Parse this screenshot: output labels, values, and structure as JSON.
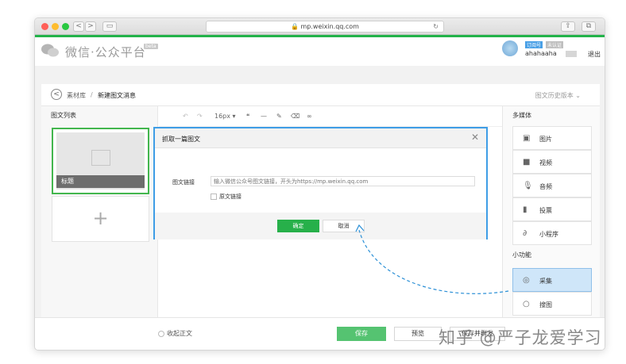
{
  "browser": {
    "url": "mp.weixin.qq.com",
    "nav_back": "<",
    "nav_forward": ">",
    "reload": "↻",
    "traffic_colors": [
      "#ff5f57",
      "#febc2e",
      "#28c840"
    ]
  },
  "header": {
    "logo_text": "微信·公众平台",
    "beta_label": "beta",
    "badge_1": "订阅号",
    "badge_2": "未认证",
    "username": "ahahaaha",
    "logout": "退出"
  },
  "breadcrumb": {
    "parent": "素材库",
    "separator": "/",
    "current": "新建图文消息",
    "history": "图文历史版本"
  },
  "left_column": {
    "title": "图文列表",
    "article_title": "标题",
    "add_symbol": "+"
  },
  "toolbar": {
    "undo": "↶",
    "redo": "↷",
    "font_size": "16px",
    "quote": "❝",
    "hr": "—",
    "format": "✎",
    "clear": "⌫",
    "link": "∞"
  },
  "right_column": {
    "media_title": "多媒体",
    "media_items": [
      {
        "label": "图片",
        "icon": "▣"
      },
      {
        "label": "视频",
        "icon": "■"
      },
      {
        "label": "音频",
        "icon": "🎙"
      },
      {
        "label": "投票",
        "icon": "▮"
      },
      {
        "label": "小程序",
        "icon": "∂"
      }
    ],
    "tools_title": "小功能",
    "tool_items": [
      {
        "label": "采集",
        "icon": "◎"
      },
      {
        "label": "搜图",
        "icon": "○"
      }
    ]
  },
  "footer": {
    "collapse": "收起正文",
    "save": "保存",
    "preview": "预览",
    "publish": "保存并群发"
  },
  "modal": {
    "title": "抓取一篇图文",
    "close": "✕",
    "field_label": "图文链接",
    "placeholder": "输入微信公众号图文链接，开头为https://mp.weixin.qq.com",
    "checkbox_label": "原文链接",
    "ok": "确定",
    "cancel": "取消"
  },
  "watermark": "知乎 @严子龙爱学习",
  "colors": {
    "accent_green": "#23b34a",
    "modal_border": "#3e9de6",
    "active_item": "#cfe6f9"
  }
}
